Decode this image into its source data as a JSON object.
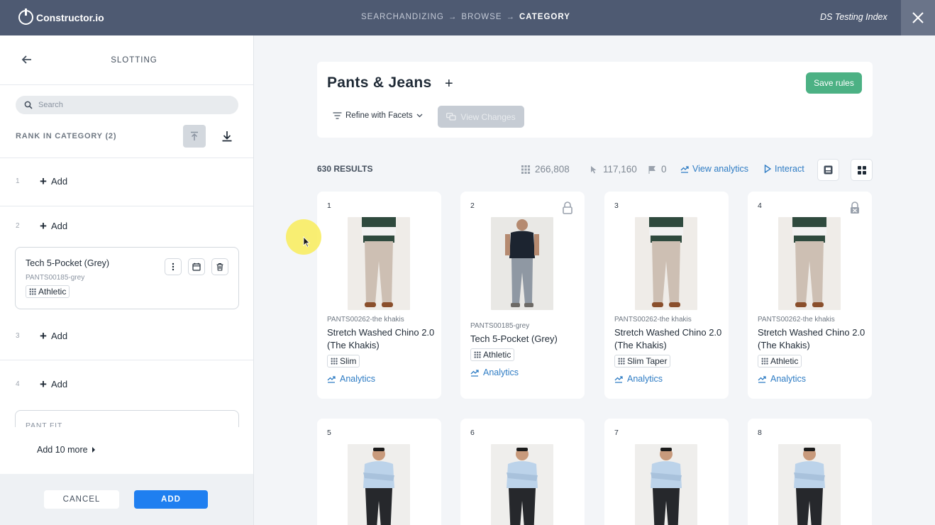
{
  "topbar": {
    "logo_text": "Constructor.io",
    "breadcrumbs": [
      "SEARCHANDIZING",
      "BROWSE",
      "CATEGORY"
    ],
    "separator": "→",
    "index_name": "DS Testing Index"
  },
  "sidebar": {
    "title": "SLOTTING",
    "search_placeholder": "Search",
    "rank_label": "RANK IN CATEGORY (2)",
    "add_label": "Add",
    "slots": [
      {
        "num": "1"
      },
      {
        "num": "2"
      },
      {
        "num": "3"
      },
      {
        "num": "4"
      }
    ],
    "pinned_item": {
      "name": "Tech 5-Pocket (Grey)",
      "sku": "PANTS00185-grey",
      "fit": "Athletic"
    },
    "partial_card_label": "PANT FIT",
    "add_more": "Add 10 more",
    "cancel": "CANCEL",
    "add": "ADD"
  },
  "category": {
    "title": "Pants & Jeans",
    "plus": "+",
    "save_rules": "Save rules",
    "refine": "Refine with Facets",
    "view_changes": "View Changes"
  },
  "results": {
    "count": "630 RESULTS",
    "stat_items": "266,808",
    "stat_clicks": "117,160",
    "stat_flags": "0",
    "view_analytics": "View analytics",
    "interact": "Interact"
  },
  "products": [
    {
      "num": "1",
      "sku": "PANTS00262-the khakis",
      "title": "Stretch Washed Chino 2.0 (The Khakis)",
      "fit": "Slim",
      "analytics": "Analytics",
      "lock": "none",
      "style": "khaki"
    },
    {
      "num": "2",
      "sku": "PANTS00185-grey",
      "title": "Tech 5-Pocket (Grey)",
      "fit": "Athletic",
      "analytics": "Analytics",
      "lock": "lock-icon",
      "style": "grey"
    },
    {
      "num": "3",
      "sku": "PANTS00262-the khakis",
      "title": "Stretch Washed Chino 2.0 (The Khakis)",
      "fit": "Slim Taper",
      "analytics": "Analytics",
      "lock": "none",
      "style": "khaki"
    },
    {
      "num": "4",
      "sku": "PANTS00262-the khakis",
      "title": "Stretch Washed Chino 2.0 (The Khakis)",
      "fit": "Athletic",
      "analytics": "Analytics",
      "lock": "unlock-icon",
      "style": "khaki"
    },
    {
      "num": "5",
      "style": "dark"
    },
    {
      "num": "6",
      "style": "dark"
    },
    {
      "num": "7",
      "style": "dark"
    },
    {
      "num": "8",
      "style": "dark"
    }
  ],
  "colors": {
    "topbar": "#4e5a72",
    "accent_blue": "#1f7ff0",
    "save_green": "#4cb184",
    "link_blue": "#2e7cc4"
  }
}
